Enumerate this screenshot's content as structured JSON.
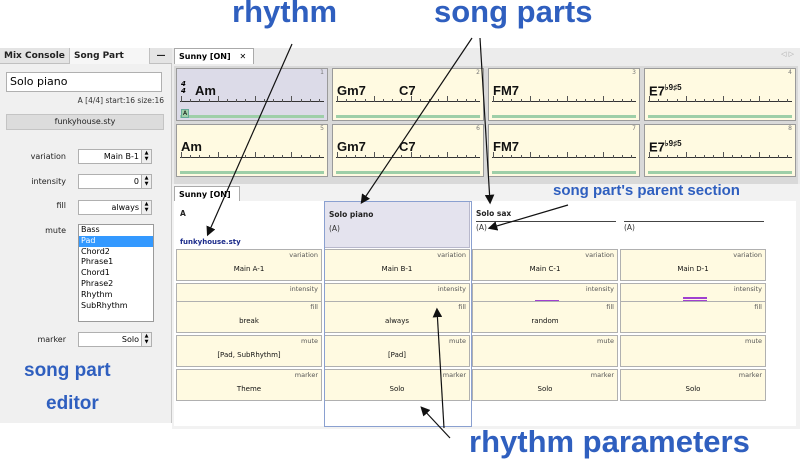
{
  "annotations": {
    "rhythm": "rhythm",
    "song_parts": "song parts",
    "parent_section": "song part's parent section",
    "editor_line1": "song part",
    "editor_line2": "editor",
    "rhythm_params": "rhythm parameters"
  },
  "left_panel": {
    "tabs": [
      "Mix Console",
      "Song Part"
    ],
    "minimize": "—",
    "name_value": "Solo piano",
    "info": "A [4/4] start:16 size:16",
    "style": "funkyhouse.sty",
    "variation_label": "variation",
    "variation_value": "Main B-1",
    "intensity_label": "intensity",
    "intensity_value": "0",
    "fill_label": "fill",
    "fill_value": "always",
    "mute_label": "mute",
    "mute_items": [
      "Bass",
      "Pad",
      "Chord2",
      "Phrase1",
      "Chord1",
      "Phrase2",
      "Rhythm",
      "SubRhythm"
    ],
    "marker_label": "marker",
    "marker_value": "Solo"
  },
  "top_tab": {
    "label": "Sunny [ON]",
    "close": "✕",
    "nav": "◁ ▷"
  },
  "chord_bars": [
    {
      "num": "1",
      "chord1": "Am",
      "chord2": "",
      "time_sig": "4/4",
      "marker": "A"
    },
    {
      "num": "2",
      "chord1": "Gm7",
      "chord2": "C7"
    },
    {
      "num": "3",
      "chord1": "FM7",
      "chord2": ""
    },
    {
      "num": "4",
      "chord1": "E7",
      "sup": "♭9♯5",
      "chord2": ""
    },
    {
      "num": "5",
      "chord1": "Am",
      "chord2": ""
    },
    {
      "num": "6",
      "chord1": "Gm7",
      "chord2": "C7"
    },
    {
      "num": "7",
      "chord1": "FM7",
      "chord2": ""
    },
    {
      "num": "8",
      "chord1": "E7",
      "sup": "♭9♯5",
      "chord2": ""
    }
  ],
  "bottom_tab": {
    "label": "Sunny [ON]",
    "close": "✕"
  },
  "song_parts": [
    {
      "title": "A",
      "parent": "",
      "style": "funkyhouse.sty",
      "variation": "Main A-1",
      "intensity": 0,
      "fill": "break",
      "mute": "[Pad, SubRhythm]",
      "marker": "Theme"
    },
    {
      "title": "Solo piano",
      "parent": "(A)",
      "style": "",
      "variation": "Main B-1",
      "intensity": 0,
      "fill": "always",
      "mute": "[Pad]",
      "marker": "Solo"
    },
    {
      "title": "Solo sax",
      "parent": "(A)",
      "style": "",
      "variation": "Main C-1",
      "intensity": 1,
      "fill": "random",
      "mute": "",
      "marker": "Solo"
    },
    {
      "title": "",
      "parent": "(A)",
      "style": "",
      "variation": "Main D-1",
      "intensity": 2,
      "fill": "",
      "mute": "",
      "marker": "Solo"
    }
  ],
  "param_names": {
    "variation": "variation",
    "intensity": "intensity",
    "fill": "fill",
    "mute": "mute",
    "marker": "marker"
  },
  "colors": {
    "annotation": "#2f5fbf",
    "cell_bg": "#fffae1",
    "selected_cell": "#dcdbe8",
    "list_selection": "#3399ff",
    "intensity_bar": "#a040d0"
  }
}
